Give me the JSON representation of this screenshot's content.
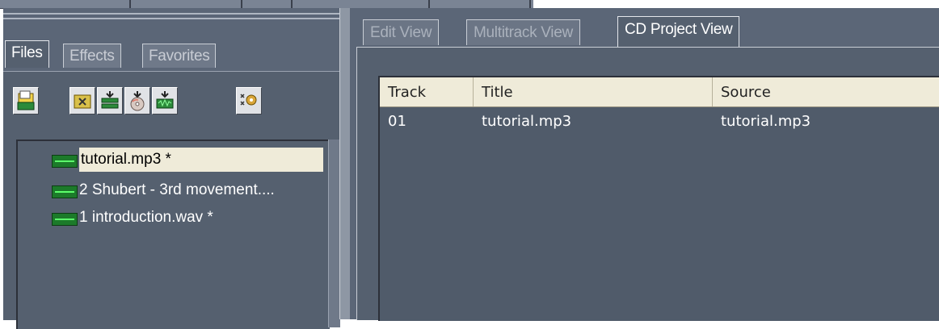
{
  "left_panel": {
    "tabs": [
      {
        "label": "Files",
        "active": true
      },
      {
        "label": "Effects",
        "active": false
      },
      {
        "label": "Favorites",
        "active": false
      }
    ],
    "toolbar": [
      {
        "icon": "open-file-icon"
      },
      {
        "icon": "close-file-icon"
      },
      {
        "icon": "insert-multitrack-icon"
      },
      {
        "icon": "insert-cd-icon"
      },
      {
        "icon": "insert-audio-icon"
      },
      {
        "icon": "options-gear-icon"
      }
    ],
    "files": [
      {
        "name": "tutorial.mp3 *",
        "selected": true
      },
      {
        "name": "2 Shubert - 3rd movement....",
        "selected": false
      },
      {
        "name": "1 introduction.wav *",
        "selected": false
      }
    ]
  },
  "right_panel": {
    "tabs": [
      {
        "label": "Edit View",
        "active": false
      },
      {
        "label": "Multitrack View",
        "active": false
      },
      {
        "label": "CD Project View",
        "active": true
      }
    ],
    "table": {
      "columns": [
        "Track",
        "Title",
        "Source"
      ],
      "rows": [
        [
          "01",
          "tutorial.mp3",
          "tutorial.mp3"
        ]
      ]
    }
  },
  "colors": {
    "panel_bg": "#55606f",
    "selection_bg": "#efebd9",
    "header_bg": "#efebd9",
    "waveform_icon": "#1c7a2a"
  }
}
